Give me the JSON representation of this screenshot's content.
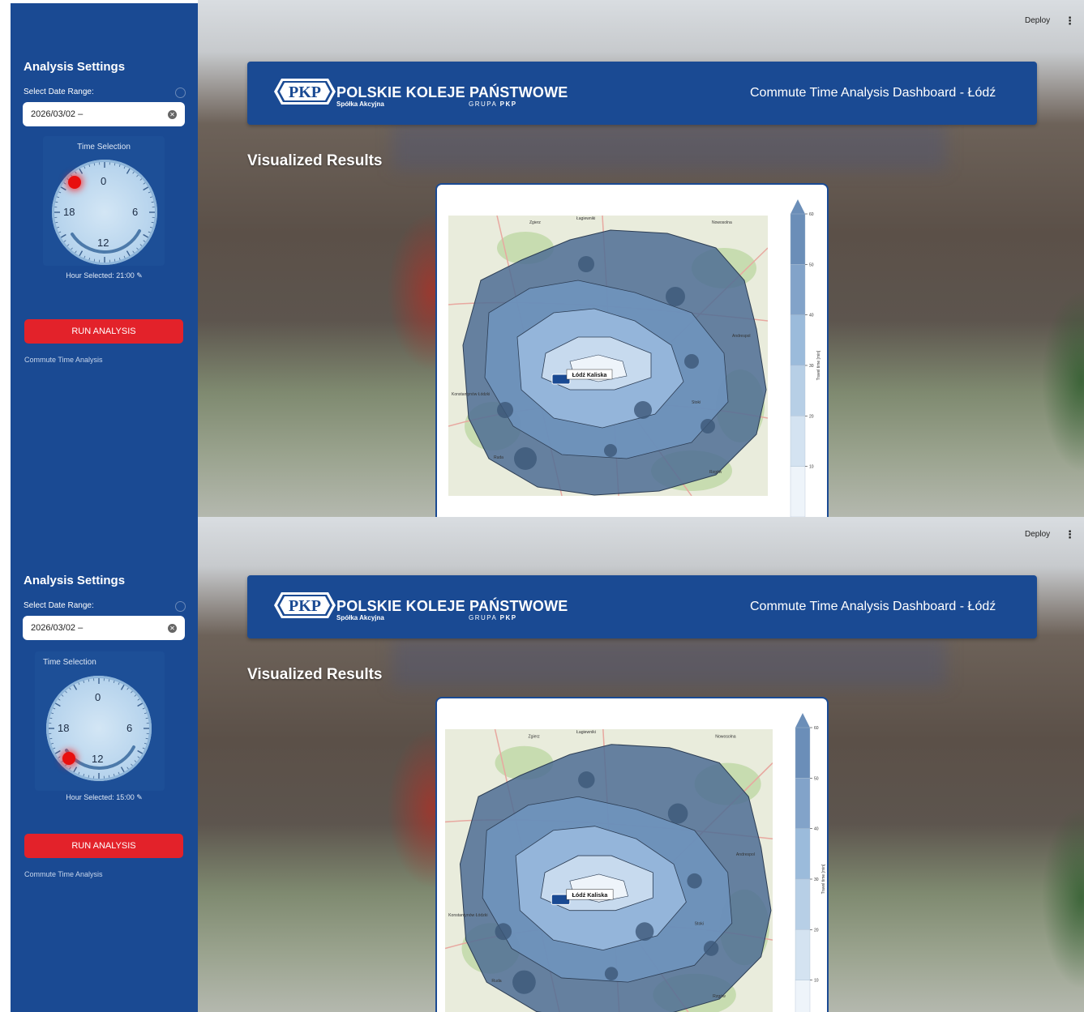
{
  "topbar": {
    "deploy_label": "Deploy",
    "menu_icon": "more-vertical-icon"
  },
  "sidebar": {
    "title": "Analysis Settings",
    "date_label": "Select Date Range:",
    "date_value": "2026/03/02 –",
    "time_selection_label": "Time Selection",
    "run_button_label": "RUN ANALYSIS",
    "link_label": "Commute Time Analysis"
  },
  "header": {
    "logo_text": "PKP",
    "company_name": "POLSKIE KOLEJE PAŃSTWOWE",
    "company_sub": "Spółka Akcyjna",
    "grupa_prefix": "GRUPA",
    "grupa_brand": "PKP",
    "title": "Commute Time Analysis Dashboard - Łódź"
  },
  "section_title": "Visualized Results",
  "clock": {
    "labels": [
      "0",
      "6",
      "12",
      "18"
    ]
  },
  "states": [
    {
      "hour_selected": "Hour Selected: 21:00",
      "selected_hour": 21
    },
    {
      "hour_selected": "Hour Selected: 15:00",
      "selected_hour": 15
    }
  ],
  "map": {
    "station_label": "Łódź Kaliska",
    "place_labels": [
      "Zgierz",
      "Łagiewniki",
      "Nowosolna",
      "Andrespol",
      "Rzgów",
      "Konstantynów Łódzki",
      "Stoki",
      "Ruda"
    ]
  },
  "colorbar": {
    "ticks": [
      "60",
      "50",
      "40",
      "30",
      "20",
      "10"
    ],
    "label": "Travel time [min]"
  },
  "colors": {
    "brand_blue": "#1a4a93",
    "run_red": "#e3222a"
  }
}
